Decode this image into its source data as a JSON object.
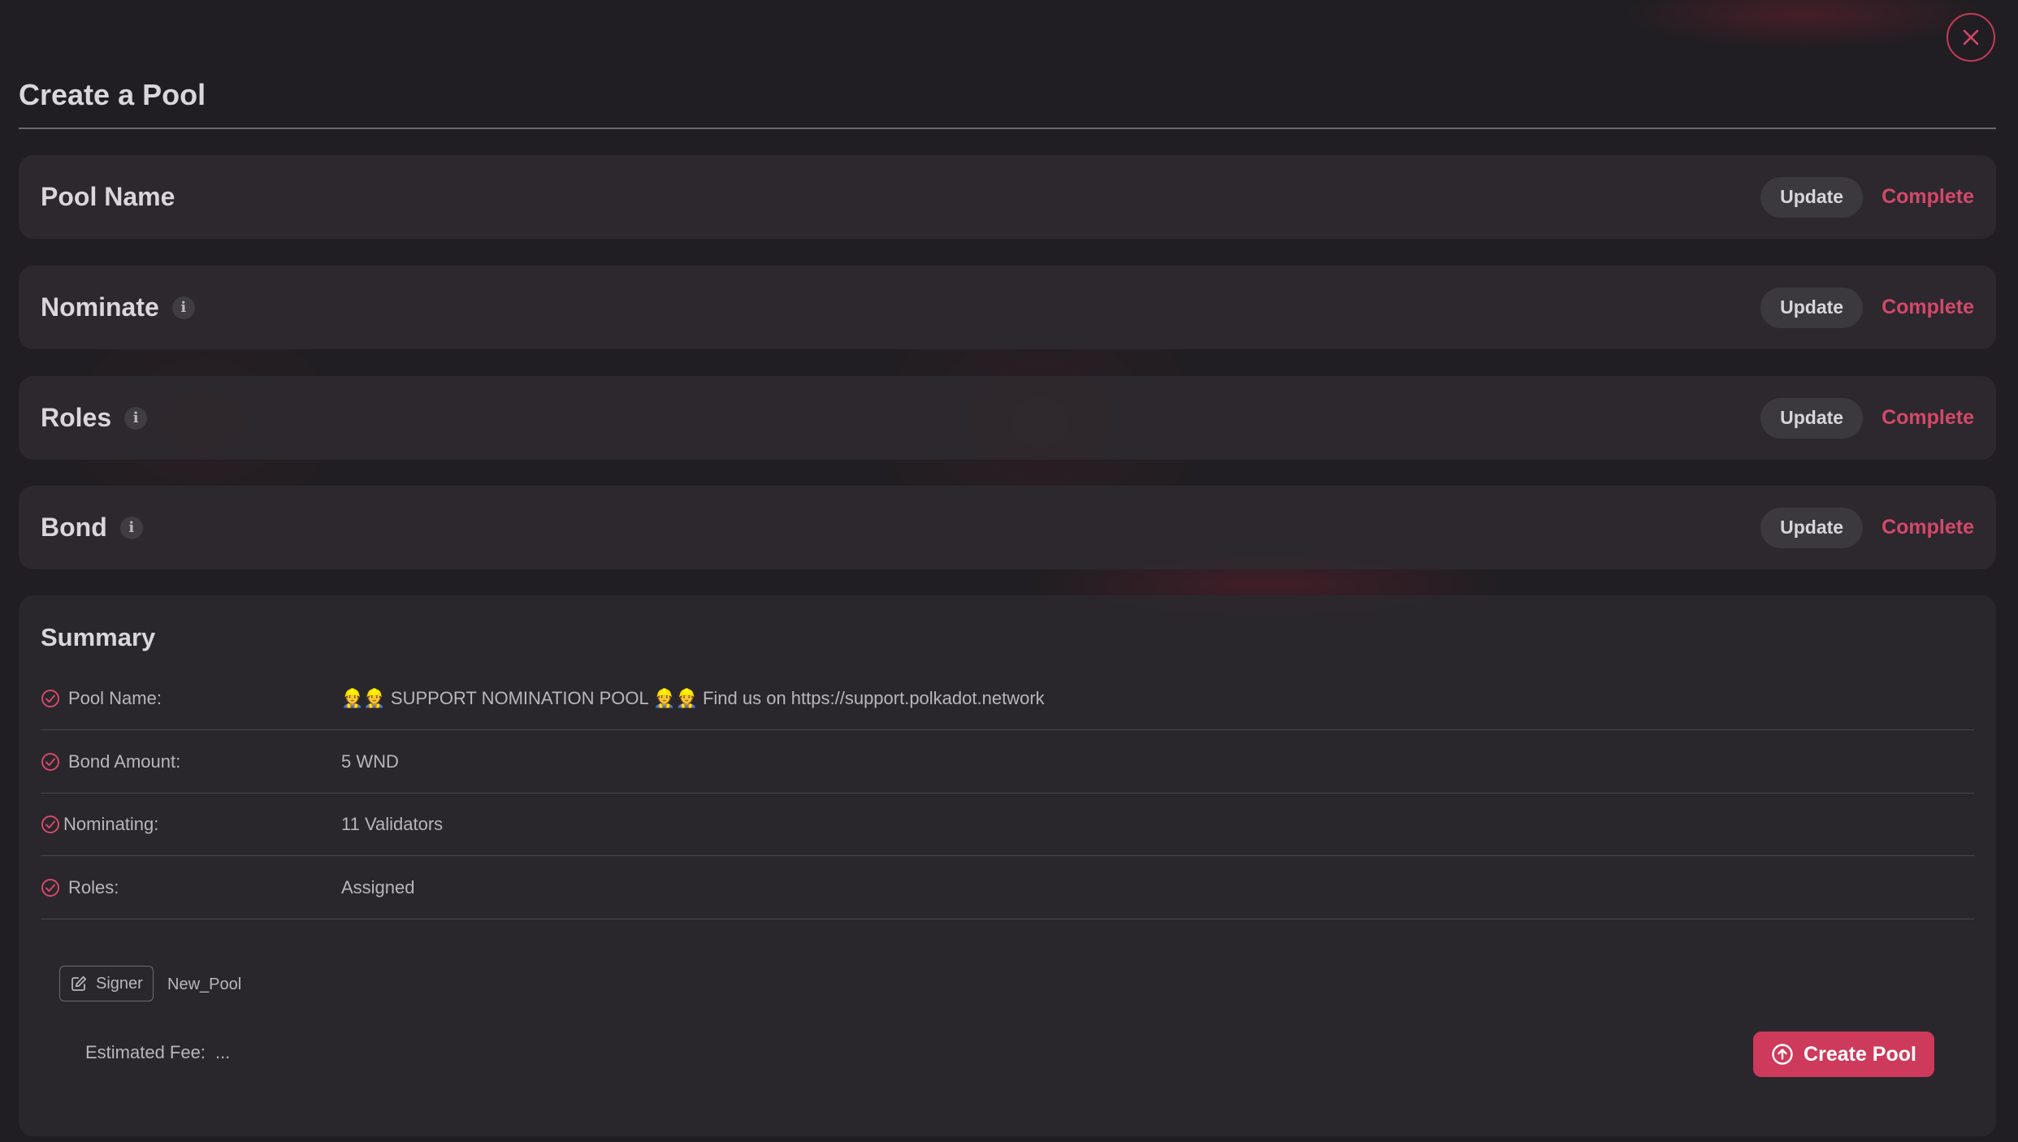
{
  "header": {
    "title": "Create a Pool",
    "close_icon": "close-icon"
  },
  "sections": [
    {
      "title": "Pool Name",
      "has_info": false,
      "update_label": "Update",
      "status": "Complete"
    },
    {
      "title": "Nominate",
      "has_info": true,
      "update_label": "Update",
      "status": "Complete"
    },
    {
      "title": "Roles",
      "has_info": true,
      "update_label": "Update",
      "status": "Complete"
    },
    {
      "title": "Bond",
      "has_info": true,
      "update_label": "Update",
      "status": "Complete"
    }
  ],
  "summary": {
    "title": "Summary",
    "rows": [
      {
        "label": "Pool Name:",
        "value_prefix": "👷👷",
        "value_middle": " SUPPORT NOMINATION POOL ",
        "value_emoji2": "👷👷",
        "value_suffix": " Find us on https://support.polkadot.network"
      },
      {
        "label": "Bond Amount:",
        "value": "5 WND"
      },
      {
        "label": "Nominating:",
        "value": "11 Validators"
      },
      {
        "label": "Roles:",
        "value": "Assigned"
      }
    ],
    "signer_label": "Signer",
    "signer_name": "New_Pool",
    "fee_label": "Estimated Fee:",
    "fee_value": "...",
    "submit_label": "Create Pool"
  },
  "colors": {
    "accent": "#cd3a5b",
    "background": "#201e22",
    "panel": "#2f2c32"
  }
}
